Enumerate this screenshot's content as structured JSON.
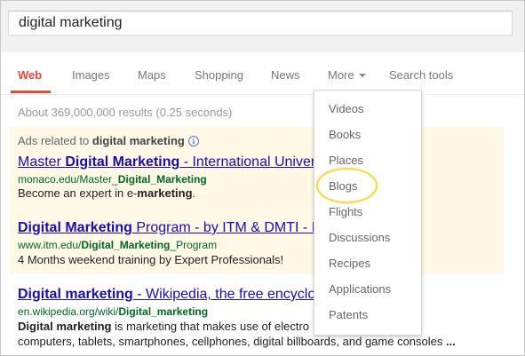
{
  "search": {
    "query": "digital marketing"
  },
  "tabs": [
    {
      "label": "Web"
    },
    {
      "label": "Images"
    },
    {
      "label": "Maps"
    },
    {
      "label": "Shopping"
    },
    {
      "label": "News"
    },
    {
      "label": "More"
    },
    {
      "label": "Search tools"
    }
  ],
  "stats": "About 369,000,000 results (0.25 seconds)",
  "ads": {
    "header_prefix": "Ads related to ",
    "header_query": "digital marketing",
    "items": [
      {
        "title_a": "Master ",
        "title_b": "Digital Marketing",
        "title_c": " - International Universi",
        "url_a": "monaco.edu/Master_",
        "url_b": "Digital_Marketing",
        "snippet_a": "Become an expert in e-",
        "snippet_b": "marketing",
        "snippet_c": "."
      },
      {
        "title_a": "",
        "title_b": "Digital Marketing",
        "title_c": " Program - by ITM & DMTI - IT",
        "url_a": "www.itm.edu/",
        "url_b": "Digital_Marketing",
        "url_c": "_Program",
        "snippet": "4 Months weekend training by Expert Professionals!"
      }
    ]
  },
  "organic": {
    "title_a": "Digital marketing",
    "title_b": " - Wikipedia, the free encyclop",
    "url_a": "en.wikipedia.org/wiki/",
    "url_b": "Digital_marketing",
    "snippet1_a": "Digital marketing",
    "snippet1_b": " is marketing that makes use of electro",
    "snippet2_a": "computers, tablets, smartphones, cellphones, digital billboards, and game consoles ",
    "snippet2_b": "..."
  },
  "more_menu": {
    "items": [
      "Videos",
      "Books",
      "Places",
      "Blogs",
      "Flights",
      "Discussions",
      "Recipes",
      "Applications",
      "Patents"
    ],
    "highlighted": "Blogs",
    "highlight_color": "#f6d94a"
  },
  "colors": {
    "accent": "#dd4b39",
    "link": "#1a0dab",
    "url": "#006621",
    "ad_bg": "#fff8e7"
  }
}
